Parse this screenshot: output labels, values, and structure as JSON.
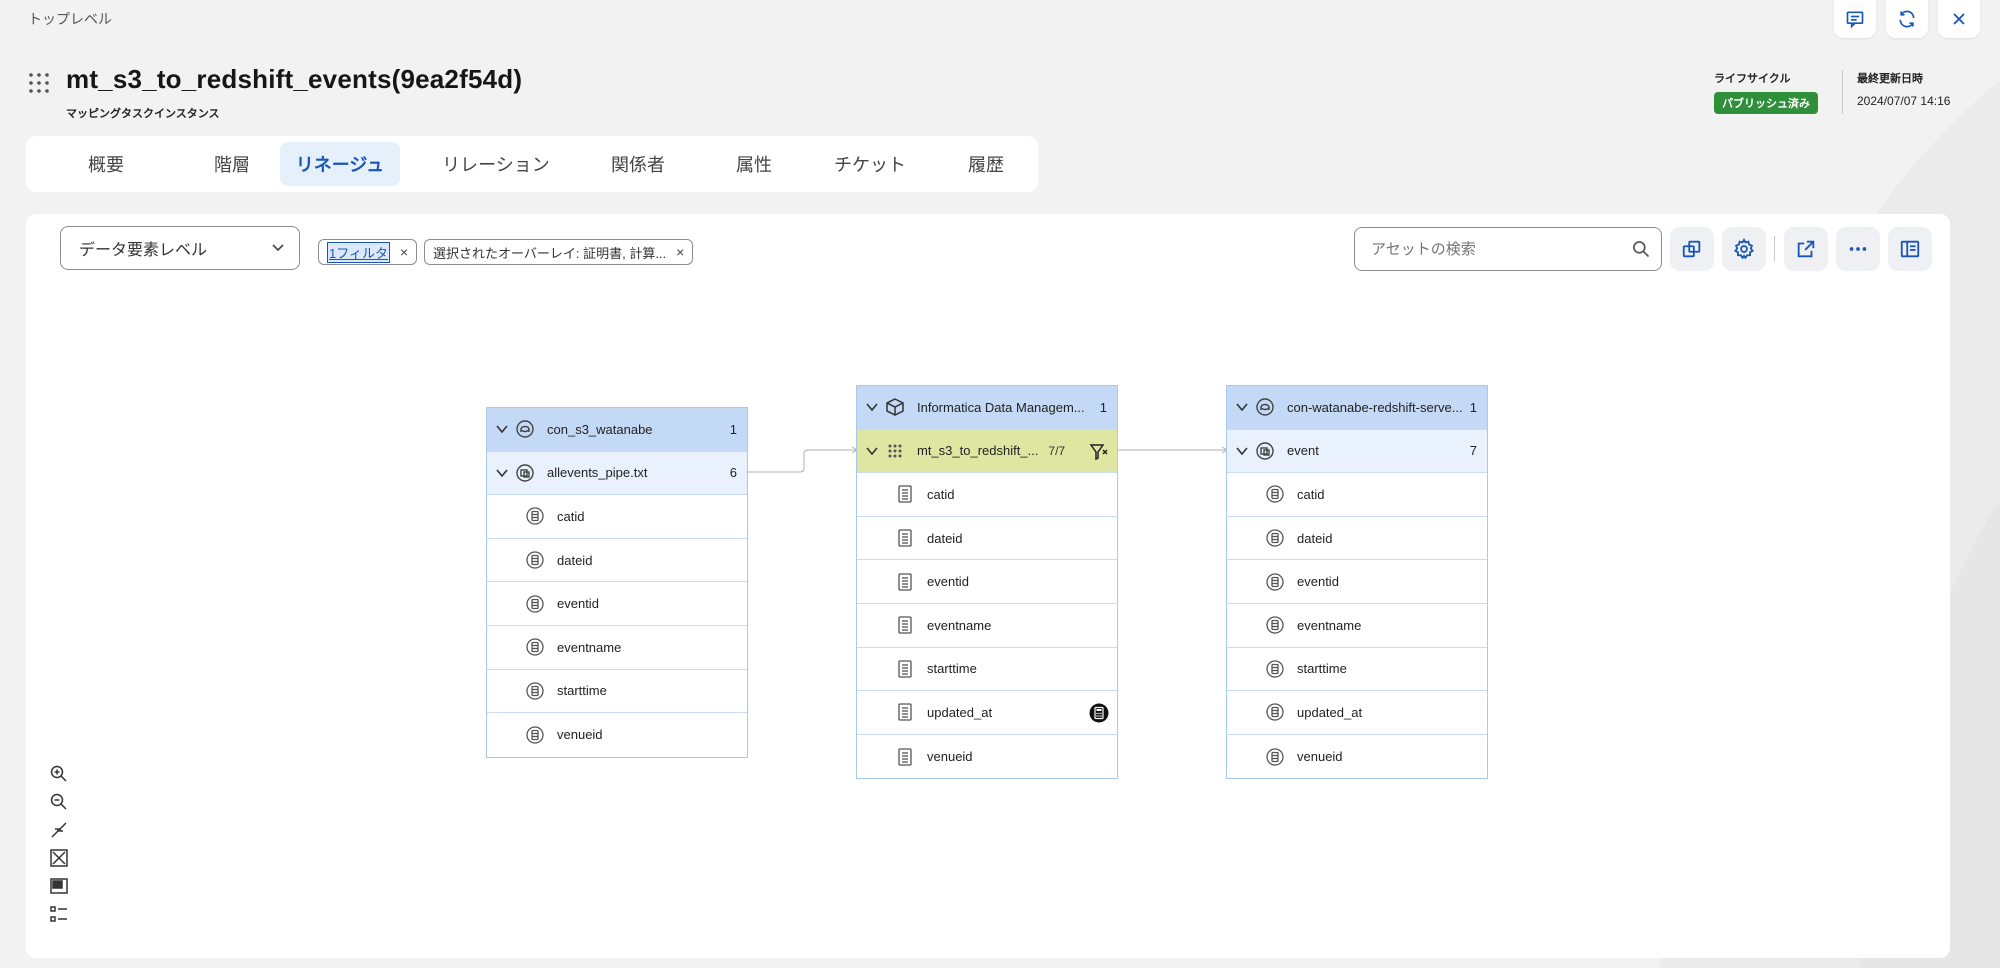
{
  "breadcrumb": "トップレベル",
  "header": {
    "title": "mt_s3_to_redshift_events(9ea2f54d)",
    "subtitle": "マッピングタスクインスタンス",
    "lifecycle_label": "ライフサイクル",
    "lifecycle_value": "パブリッシュ済み",
    "updated_label": "最終更新日時",
    "updated_value": "2024/07/07 14:16"
  },
  "top_actions": [
    "comment-icon",
    "refresh-icon",
    "close-icon"
  ],
  "tabs": [
    {
      "label": "概要"
    },
    {
      "label": "階層"
    },
    {
      "label": "リネージュ",
      "active": true
    },
    {
      "label": "リレーション"
    },
    {
      "label": "関係者"
    },
    {
      "label": "属性"
    },
    {
      "label": "チケット"
    },
    {
      "label": "履歴"
    }
  ],
  "toolbar": {
    "level_select": "データ要素レベル",
    "filter_chip": "1フィルタ",
    "overlay_chip": "選択されたオーバーレイ: 証明書, 計算...",
    "search_placeholder": "アセットの検索"
  },
  "lineage": {
    "source": {
      "connection": "con_s3_watanabe",
      "connection_count": "1",
      "object": "allevents_pipe.txt",
      "object_count": "6",
      "fields": [
        "catid",
        "dateid",
        "eventid",
        "eventname",
        "starttime",
        "venueid"
      ]
    },
    "transform": {
      "connection": "Informatica Data Managem...",
      "connection_count": "1",
      "object": "mt_s3_to_redshift_...",
      "object_count": "7/7",
      "fields": [
        "catid",
        "dateid",
        "eventid",
        "eventname",
        "starttime",
        "updated_at",
        "venueid"
      ]
    },
    "target": {
      "connection": "con-watanabe-redshift-serve...",
      "connection_count": "1",
      "object": "event",
      "object_count": "7",
      "fields": [
        "catid",
        "dateid",
        "eventid",
        "eventname",
        "starttime",
        "updated_at",
        "venueid"
      ]
    }
  },
  "colors": {
    "accent": "#1a56b8",
    "badge_green": "#2f8f3a",
    "header_blue": "#c4d9f5",
    "transform_green": "#dfe6a2"
  }
}
